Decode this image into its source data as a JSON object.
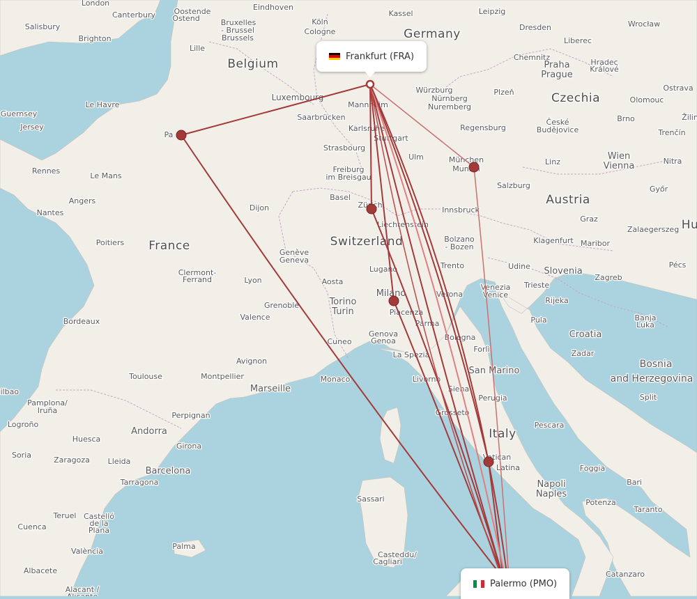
{
  "map": {
    "colors": {
      "sea": "#aad3df",
      "land": "#f2efe9",
      "route": "#a33a3a",
      "route_light": "#e08a8a",
      "stop": "#a33a3a"
    },
    "origin": {
      "label": "Frankfurt (FRA)",
      "country_flag": "germany-flag"
    },
    "destination": {
      "label": "Palermo (PMO)",
      "country_flag": "italy-flag"
    },
    "stopovers": [
      "Paris",
      "Zürich",
      "Milano",
      "München",
      "Vatican"
    ],
    "countries": [
      {
        "name": "Germany"
      },
      {
        "name": "Belgium"
      },
      {
        "name": "Czechia"
      },
      {
        "name": "France"
      },
      {
        "name": "Switzerland"
      },
      {
        "name": "Austria"
      },
      {
        "name": "Slovenia"
      },
      {
        "name": "Croatia"
      },
      {
        "name": "Italy"
      },
      {
        "name": "Bosnia"
      },
      {
        "name": "and Herzegovina"
      },
      {
        "name": "Hu"
      }
    ],
    "cities": [
      {
        "name": "London"
      },
      {
        "name": "Canterbury"
      },
      {
        "name": "Salisbury"
      },
      {
        "name": "Brighton"
      },
      {
        "name": "Oostende"
      },
      {
        "name": "Ostend"
      },
      {
        "name": "Eindhoven"
      },
      {
        "name": "Köln"
      },
      {
        "name": "Cologne"
      },
      {
        "name": "Kassel"
      },
      {
        "name": "Leipzig"
      },
      {
        "name": "Dresden"
      },
      {
        "name": "Wrocław"
      },
      {
        "name": "Bruxelles"
      },
      {
        "name": "- Brussel"
      },
      {
        "name": "Brussels"
      },
      {
        "name": "Lille"
      },
      {
        "name": "Chemnitz"
      },
      {
        "name": "Liberec"
      },
      {
        "name": "Praha"
      },
      {
        "name": "Prague"
      },
      {
        "name": "Hradec"
      },
      {
        "name": "Králové"
      },
      {
        "name": "Ostrava"
      },
      {
        "name": "Olomouc"
      },
      {
        "name": "Luxembourg"
      },
      {
        "name": "Würzburg"
      },
      {
        "name": "Plzeň"
      },
      {
        "name": "Le Havre"
      },
      {
        "name": "Guernsey"
      },
      {
        "name": "Jersey"
      },
      {
        "name": "Mannheim"
      },
      {
        "name": "Nürnberg"
      },
      {
        "name": "Nuremberg"
      },
      {
        "name": "Saarbrücken"
      },
      {
        "name": "Karlsruhe"
      },
      {
        "name": "Regensburg"
      },
      {
        "name": "České"
      },
      {
        "name": "Budějovice"
      },
      {
        "name": "Brno"
      },
      {
        "name": "Trenčín"
      },
      {
        "name": "Žilin"
      },
      {
        "name": "Pa"
      },
      {
        "name": "Stuttgart"
      },
      {
        "name": "Strasbourg"
      },
      {
        "name": "Ulm"
      },
      {
        "name": "München"
      },
      {
        "name": "Munich"
      },
      {
        "name": "Linz"
      },
      {
        "name": "Wien"
      },
      {
        "name": "Vienna"
      },
      {
        "name": "Nitra"
      },
      {
        "name": "Rennes"
      },
      {
        "name": "Le Mans"
      },
      {
        "name": "Freiburg"
      },
      {
        "name": "im Breisgau"
      },
      {
        "name": "Salzburg"
      },
      {
        "name": "Győr"
      },
      {
        "name": "Angers"
      },
      {
        "name": "Nantes"
      },
      {
        "name": "Basel"
      },
      {
        "name": "Zürich"
      },
      {
        "name": "Dijon"
      },
      {
        "name": "Innsbruck"
      },
      {
        "name": "Graz"
      },
      {
        "name": "Liechtenstein"
      },
      {
        "name": "Zalaegerszeg"
      },
      {
        "name": "Poitiers"
      },
      {
        "name": "Bolzano"
      },
      {
        "name": "- Bozen"
      },
      {
        "name": "Klagenfurt"
      },
      {
        "name": "Maribor"
      },
      {
        "name": "Genève"
      },
      {
        "name": "Geneva"
      },
      {
        "name": "Clermont-"
      },
      {
        "name": "Ferrand"
      },
      {
        "name": "Lugano"
      },
      {
        "name": "Trento"
      },
      {
        "name": "Udine"
      },
      {
        "name": "Pécs"
      },
      {
        "name": "Lyon"
      },
      {
        "name": "Aosta"
      },
      {
        "name": "Milano"
      },
      {
        "name": "Verona"
      },
      {
        "name": "Venezia"
      },
      {
        "name": "Venice"
      },
      {
        "name": "Trieste"
      },
      {
        "name": "Zagreb"
      },
      {
        "name": "Rijeka"
      },
      {
        "name": "Grenoble"
      },
      {
        "name": "Torino"
      },
      {
        "name": "Turin"
      },
      {
        "name": "Bordeaux"
      },
      {
        "name": "Valence"
      },
      {
        "name": "Piacenza"
      },
      {
        "name": "Parma"
      },
      {
        "name": "Pula"
      },
      {
        "name": "Banja"
      },
      {
        "name": "Luka"
      },
      {
        "name": "Genova"
      },
      {
        "name": "Genoa"
      },
      {
        "name": "Cuneo"
      },
      {
        "name": "Bologna"
      },
      {
        "name": "Forlì"
      },
      {
        "name": "Avignon"
      },
      {
        "name": "La Spezia"
      },
      {
        "name": "San Marino"
      },
      {
        "name": "Zadar"
      },
      {
        "name": "Toulouse"
      },
      {
        "name": "Montpellier"
      },
      {
        "name": "Monaco"
      },
      {
        "name": "Livorno"
      },
      {
        "name": "Siena"
      },
      {
        "name": "Marseille"
      },
      {
        "name": "Perugia"
      },
      {
        "name": "Split"
      },
      {
        "name": "Bilbao"
      },
      {
        "name": "Pamplona/"
      },
      {
        "name": "Iruña"
      },
      {
        "name": "Perpignan"
      },
      {
        "name": "Grosseto"
      },
      {
        "name": "Pescara"
      },
      {
        "name": "Logroño"
      },
      {
        "name": "Andorra"
      },
      {
        "name": "Huesca"
      },
      {
        "name": "Girona"
      },
      {
        "name": "Soria"
      },
      {
        "name": "Zaragoza"
      },
      {
        "name": "Lleida"
      },
      {
        "name": "Barcelona"
      },
      {
        "name": "Vatican"
      },
      {
        "name": "Latina"
      },
      {
        "name": "Foggia"
      },
      {
        "name": "Tarragona"
      },
      {
        "name": "Napoli"
      },
      {
        "name": "Naples"
      },
      {
        "name": "Bari"
      },
      {
        "name": "Teruel"
      },
      {
        "name": "Castelló"
      },
      {
        "name": "de la"
      },
      {
        "name": "Plana"
      },
      {
        "name": "Sassari"
      },
      {
        "name": "Potenza"
      },
      {
        "name": "Taranto"
      },
      {
        "name": "Cuenca"
      },
      {
        "name": "València"
      },
      {
        "name": "Palma"
      },
      {
        "name": "Albacete"
      },
      {
        "name": "Alacant /"
      },
      {
        "name": "Alicante"
      },
      {
        "name": "Cagliari"
      },
      {
        "name": "Casteddu/"
      },
      {
        "name": "Catanzaro"
      }
    ]
  }
}
